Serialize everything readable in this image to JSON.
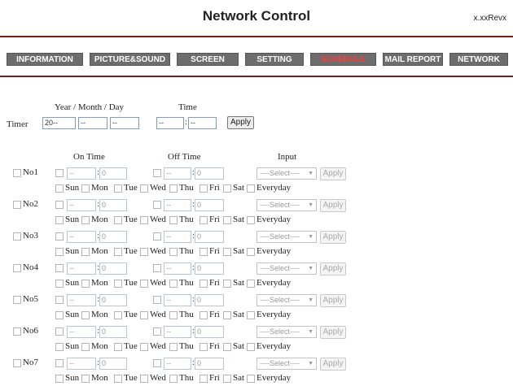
{
  "header": {
    "title": "Network Control",
    "version": "x.xxRevx"
  },
  "nav": [
    {
      "label": "INFORMATION",
      "active": false
    },
    {
      "label": "PICTURE&SOUND",
      "active": false
    },
    {
      "label": "SCREEN",
      "active": false
    },
    {
      "label": "SETTING",
      "active": false
    },
    {
      "label": "SCHEDULE",
      "active": true
    },
    {
      "label": "MAIL REPORT",
      "active": false
    },
    {
      "label": "NETWORK",
      "active": false
    }
  ],
  "timer": {
    "label": "Timer",
    "date_label": "Year / Month / Day",
    "time_label": "Time",
    "year": "20--",
    "month": "--",
    "day": "--",
    "hour": "--",
    "minute": "--",
    "apply": "Apply"
  },
  "columns": {
    "on_time": "On Time",
    "off_time": "Off Time",
    "input": "Input"
  },
  "schedule": {
    "hour_value": "--",
    "minute_value": "0",
    "select_value": "----Select----",
    "apply": "Apply",
    "days": [
      "Sun",
      "Mon",
      "Tue",
      "Wed",
      "Thu",
      "Fri",
      "Sat",
      "Everyday"
    ],
    "rows": [
      "No1",
      "No2",
      "No3",
      "No4",
      "No5",
      "No6",
      "No7"
    ]
  },
  "colors": {
    "rule": "#7a1f1f",
    "nav_bg": "#6d6d6d",
    "nav_active_text": "#ff3b3b"
  }
}
